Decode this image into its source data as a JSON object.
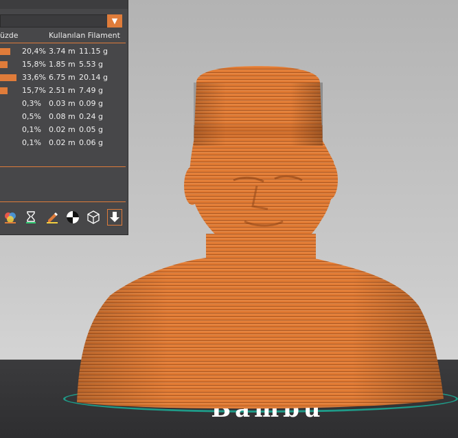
{
  "model_color": "#e07c3a",
  "panel": {
    "header": {
      "col_percent": "üzde",
      "col_filament": "Kullanılan Filament"
    },
    "rows": [
      {
        "percent": "20,4%",
        "length": "3.74 m",
        "weight": "11.15 g",
        "fraction": 0.204
      },
      {
        "percent": "15,8%",
        "length": "1.85 m",
        "weight": "5.53 g",
        "fraction": 0.158
      },
      {
        "percent": "33,6%",
        "length": "6.75 m",
        "weight": "20.14 g",
        "fraction": 0.336
      },
      {
        "percent": "15,7%",
        "length": "2.51 m",
        "weight": "7.49 g",
        "fraction": 0.157
      },
      {
        "percent": "0,3%",
        "length": "0.03 m",
        "weight": "0.09 g",
        "fraction": 0.003
      },
      {
        "percent": "0,5%",
        "length": "0.08 m",
        "weight": "0.24 g",
        "fraction": 0.005
      },
      {
        "percent": "0,1%",
        "length": "0.02 m",
        "weight": "0.05 g",
        "fraction": 0.001
      },
      {
        "percent": "0,1%",
        "length": "0.02 m",
        "weight": "0.06 g",
        "fraction": 0.001
      }
    ],
    "toolbar": [
      {
        "icon": "color-palette-icon"
      },
      {
        "icon": "hourglass-icon"
      },
      {
        "icon": "pencil-edit-icon"
      },
      {
        "icon": "contrast-circle-icon"
      },
      {
        "icon": "wireframe-cube-icon"
      },
      {
        "icon": "download-arrow-icon"
      }
    ]
  },
  "build_plate": {
    "label": "Bambu"
  }
}
